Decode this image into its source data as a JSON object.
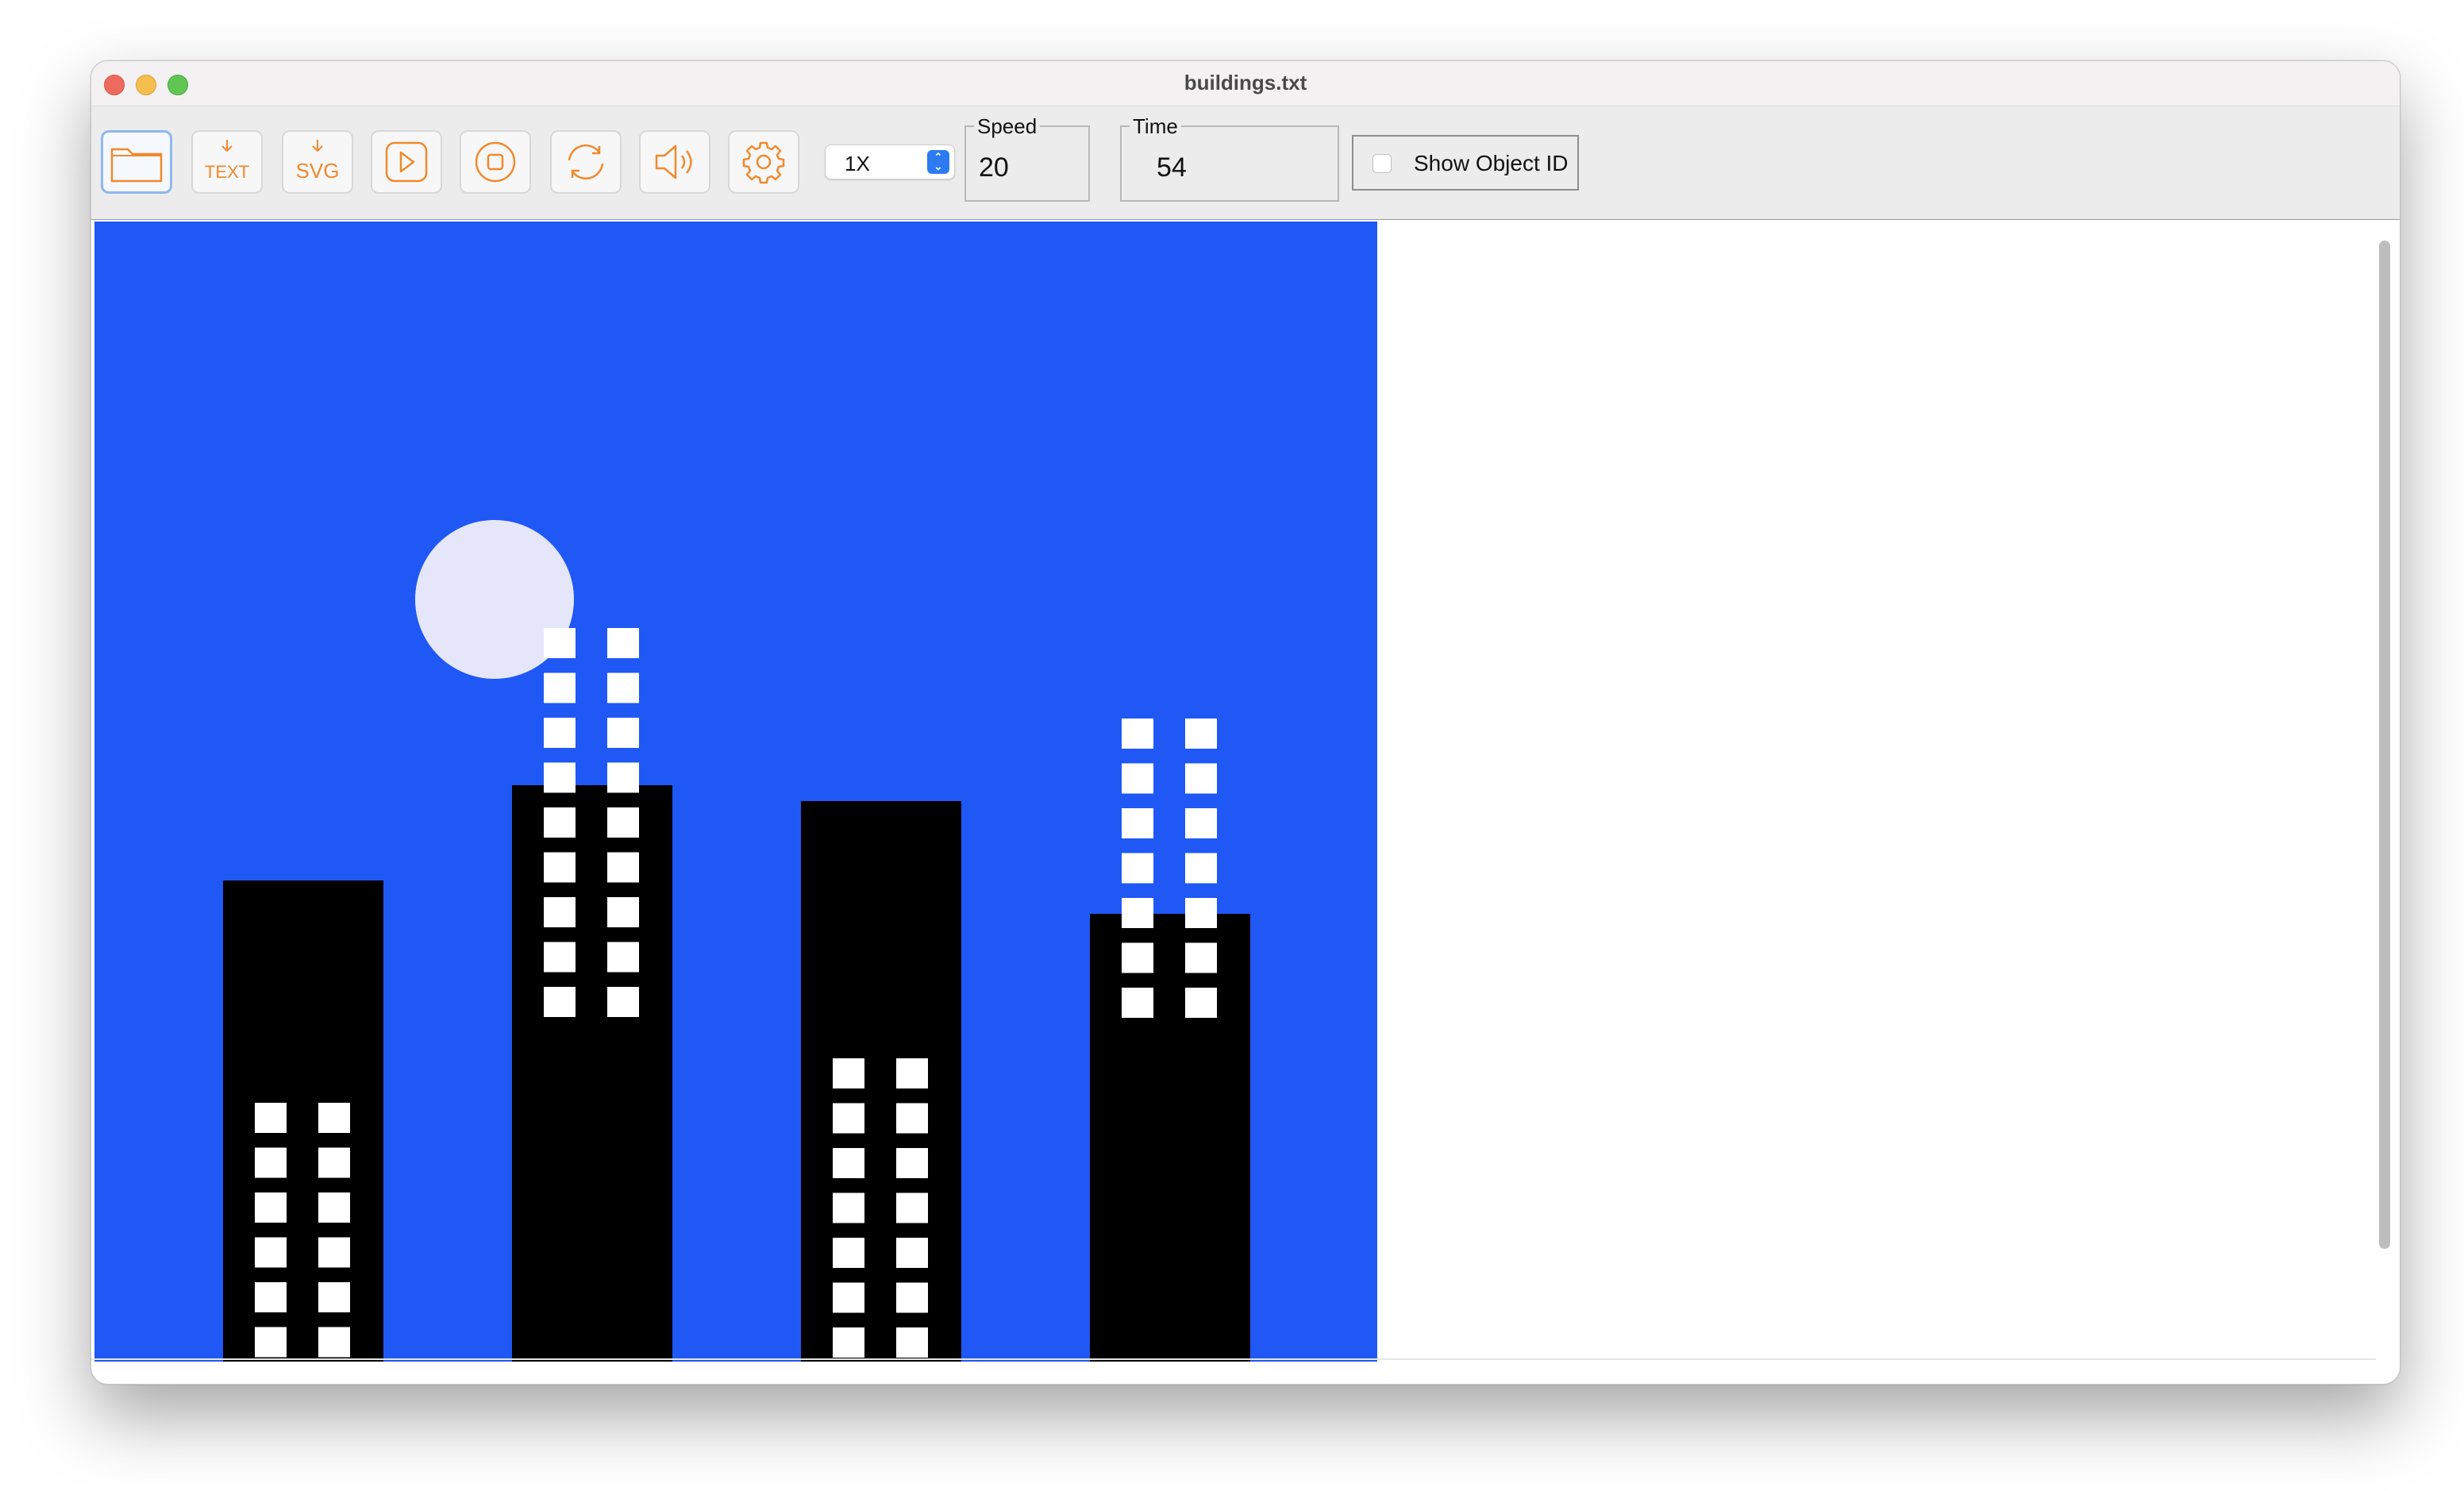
{
  "window": {
    "title": "buildings.txt"
  },
  "toolbar": {
    "buttons": [
      {
        "name": "open-file-button",
        "icon": "folder-icon"
      },
      {
        "name": "export-text-button",
        "icon": "text-export-icon",
        "label": "TEXT"
      },
      {
        "name": "export-svg-button",
        "icon": "svg-export-icon",
        "label": "SVG"
      },
      {
        "name": "play-button",
        "icon": "play-icon"
      },
      {
        "name": "stop-button",
        "icon": "stop-icon"
      },
      {
        "name": "loop-button",
        "icon": "loop-icon"
      },
      {
        "name": "sound-button",
        "icon": "speaker-icon"
      },
      {
        "name": "settings-button",
        "icon": "gear-icon"
      }
    ],
    "icon_color": "#f08a2e",
    "speed_multiplier": "1X",
    "speed_label": "Speed",
    "speed_value": "20",
    "time_label": "Time",
    "time_value": "54",
    "show_object_id_label": "Show Object ID",
    "show_object_id_checked": false
  },
  "scene": {
    "sky_color": "#2058f6",
    "moon_color": "#e6e6fb",
    "building_color": "#000000",
    "window_color": "#ffffff"
  }
}
